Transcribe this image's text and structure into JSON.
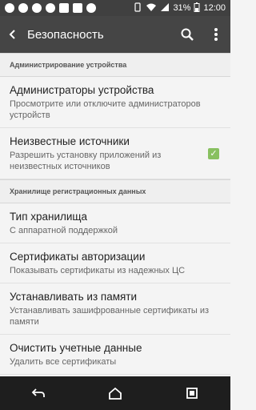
{
  "status": {
    "battery": "31%",
    "time": "12:00"
  },
  "toolbar": {
    "title": "Безопасность"
  },
  "sections": {
    "device_admin": "Администрирование устройства",
    "credential_storage": "Хранилище регистрационных данных"
  },
  "items": {
    "admins": {
      "title": "Администраторы устройства",
      "summary": "Просмотрите или отключите администраторов устройств"
    },
    "unknown": {
      "title": "Неизвестные источники",
      "summary": "Разрешить установку приложений из неизвестных источников",
      "checked": true
    },
    "storage_type": {
      "title": "Тип хранилища",
      "summary": "С аппаратной поддержкой"
    },
    "trusted_certs": {
      "title": "Сертификаты авторизации",
      "summary": "Показывать сертификаты из надежных ЦС"
    },
    "install_storage": {
      "title": "Устанавливать из памяти",
      "summary": "Устанавливать зашифрованные сертификаты из памяти"
    },
    "clear_creds": {
      "title": "Очистить учетные данные",
      "summary": "Удалить все сертификаты"
    }
  },
  "icons": {
    "statusbar": [
      "notification-icon",
      "pinterest-icon",
      "chrome-icon",
      "cloud-icon",
      "sim-icon",
      "image-icon",
      "leaf-icon",
      "vibrate-icon",
      "wifi-icon",
      "signal-icon",
      "battery-icon"
    ],
    "toolbar": [
      "back-arrow-icon",
      "search-icon",
      "overflow-menu-icon"
    ],
    "navbar": [
      "back-icon",
      "home-icon",
      "recents-icon"
    ]
  },
  "colors": {
    "toolbar": "#454545",
    "statusbar": "#404040",
    "check": "#88c060"
  }
}
